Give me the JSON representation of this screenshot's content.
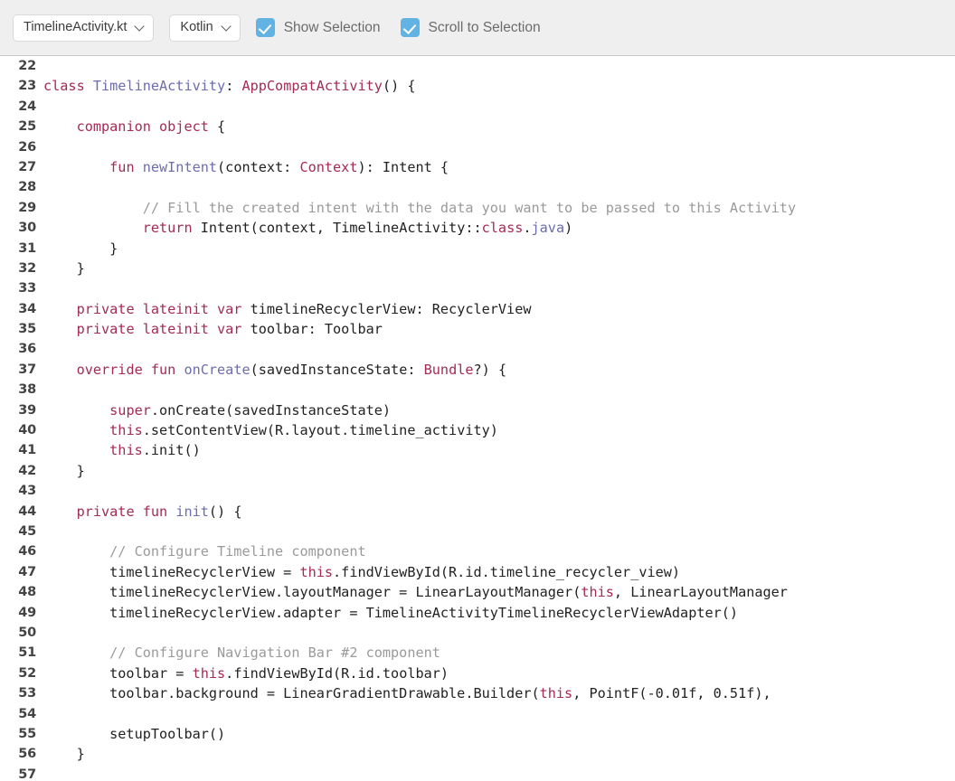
{
  "toolbar": {
    "file_select": {
      "value": "TimelineActivity.kt",
      "chevron_icon": "chevron-down-icon"
    },
    "language_select": {
      "value": "Kotlin",
      "chevron_icon": "chevron-down-icon"
    },
    "show_selection": {
      "label": "Show Selection",
      "checked": true
    },
    "scroll_to_selection": {
      "label": "Scroll to Selection",
      "checked": true
    },
    "background": "#efefef",
    "accent": "#62b3e4"
  },
  "editor": {
    "language": "Kotlin",
    "first_line": 22,
    "last_line": 57,
    "comment_color": "#9a9a9a",
    "keyword_color": "#a52a54",
    "identifier_color": "#6c6cae",
    "plain_color": "#222222",
    "lines": [
      {
        "n": "22",
        "tokens": []
      },
      {
        "n": "23",
        "tokens": [
          {
            "t": "class ",
            "c": "kw"
          },
          {
            "t": "TimelineActivity",
            "c": "idv"
          },
          {
            "t": ": ",
            "c": "pln"
          },
          {
            "t": "AppCompatActivity",
            "c": "typ"
          },
          {
            "t": "() {",
            "c": "pln"
          }
        ]
      },
      {
        "n": "24",
        "tokens": []
      },
      {
        "n": "25",
        "tokens": [
          {
            "t": "    ",
            "c": "pln"
          },
          {
            "t": "companion object",
            "c": "kw"
          },
          {
            "t": " {",
            "c": "pln"
          }
        ]
      },
      {
        "n": "26",
        "tokens": []
      },
      {
        "n": "27",
        "tokens": [
          {
            "t": "        ",
            "c": "pln"
          },
          {
            "t": "fun ",
            "c": "kw"
          },
          {
            "t": "newIntent",
            "c": "idv"
          },
          {
            "t": "(context: ",
            "c": "pln"
          },
          {
            "t": "Context",
            "c": "typ"
          },
          {
            "t": "): Intent {",
            "c": "pln"
          }
        ]
      },
      {
        "n": "28",
        "tokens": []
      },
      {
        "n": "29",
        "tokens": [
          {
            "t": "            ",
            "c": "pln"
          },
          {
            "t": "// Fill the created intent with the data you want to be passed to this Activity",
            "c": "cmt"
          }
        ]
      },
      {
        "n": "30",
        "tokens": [
          {
            "t": "            ",
            "c": "pln"
          },
          {
            "t": "return ",
            "c": "kw"
          },
          {
            "t": "Intent(context, TimelineActivity::",
            "c": "pln"
          },
          {
            "t": "class",
            "c": "kw"
          },
          {
            "t": ".",
            "c": "pln"
          },
          {
            "t": "java",
            "c": "idv"
          },
          {
            "t": ")",
            "c": "pln"
          }
        ]
      },
      {
        "n": "31",
        "tokens": [
          {
            "t": "        }",
            "c": "pln"
          }
        ]
      },
      {
        "n": "32",
        "tokens": [
          {
            "t": "    }",
            "c": "pln"
          }
        ]
      },
      {
        "n": "33",
        "tokens": []
      },
      {
        "n": "34",
        "tokens": [
          {
            "t": "    ",
            "c": "pln"
          },
          {
            "t": "private lateinit var",
            "c": "kw"
          },
          {
            "t": " timelineRecyclerView: RecyclerView",
            "c": "pln"
          }
        ]
      },
      {
        "n": "35",
        "tokens": [
          {
            "t": "    ",
            "c": "pln"
          },
          {
            "t": "private lateinit var",
            "c": "kw"
          },
          {
            "t": " toolbar: Toolbar",
            "c": "pln"
          }
        ]
      },
      {
        "n": "36",
        "tokens": []
      },
      {
        "n": "37",
        "tokens": [
          {
            "t": "    ",
            "c": "pln"
          },
          {
            "t": "override fun ",
            "c": "kw"
          },
          {
            "t": "onCreate",
            "c": "idv"
          },
          {
            "t": "(savedInstanceState: ",
            "c": "pln"
          },
          {
            "t": "Bundle",
            "c": "typ"
          },
          {
            "t": "?) {",
            "c": "pln"
          }
        ]
      },
      {
        "n": "38",
        "tokens": []
      },
      {
        "n": "39",
        "tokens": [
          {
            "t": "        ",
            "c": "pln"
          },
          {
            "t": "super",
            "c": "kw"
          },
          {
            "t": ".onCreate(savedInstanceState)",
            "c": "pln"
          }
        ]
      },
      {
        "n": "40",
        "tokens": [
          {
            "t": "        ",
            "c": "pln"
          },
          {
            "t": "this",
            "c": "kw"
          },
          {
            "t": ".setContentView(R.layout.timeline_activity)",
            "c": "pln"
          }
        ]
      },
      {
        "n": "41",
        "tokens": [
          {
            "t": "        ",
            "c": "pln"
          },
          {
            "t": "this",
            "c": "kw"
          },
          {
            "t": ".init()",
            "c": "pln"
          }
        ]
      },
      {
        "n": "42",
        "tokens": [
          {
            "t": "    }",
            "c": "pln"
          }
        ]
      },
      {
        "n": "43",
        "tokens": []
      },
      {
        "n": "44",
        "tokens": [
          {
            "t": "    ",
            "c": "pln"
          },
          {
            "t": "private fun ",
            "c": "kw"
          },
          {
            "t": "init",
            "c": "idv"
          },
          {
            "t": "() {",
            "c": "pln"
          }
        ]
      },
      {
        "n": "45",
        "tokens": []
      },
      {
        "n": "46",
        "tokens": [
          {
            "t": "        ",
            "c": "pln"
          },
          {
            "t": "// Configure Timeline component",
            "c": "cmt"
          }
        ]
      },
      {
        "n": "47",
        "tokens": [
          {
            "t": "        timelineRecyclerView = ",
            "c": "pln"
          },
          {
            "t": "this",
            "c": "kw"
          },
          {
            "t": ".findViewById(R.id.timeline_recycler_view)",
            "c": "pln"
          }
        ]
      },
      {
        "n": "48",
        "tokens": [
          {
            "t": "        timelineRecyclerView.layoutManager = LinearLayoutManager(",
            "c": "pln"
          },
          {
            "t": "this",
            "c": "kw"
          },
          {
            "t": ", LinearLayoutManager",
            "c": "pln"
          }
        ]
      },
      {
        "n": "49",
        "tokens": [
          {
            "t": "        timelineRecyclerView.adapter = TimelineActivityTimelineRecyclerViewAdapter()",
            "c": "pln"
          }
        ]
      },
      {
        "n": "50",
        "tokens": []
      },
      {
        "n": "51",
        "tokens": [
          {
            "t": "        ",
            "c": "pln"
          },
          {
            "t": "// Configure Navigation Bar #2 component",
            "c": "cmt"
          }
        ]
      },
      {
        "n": "52",
        "tokens": [
          {
            "t": "        toolbar = ",
            "c": "pln"
          },
          {
            "t": "this",
            "c": "kw"
          },
          {
            "t": ".findViewById(R.id.toolbar)",
            "c": "pln"
          }
        ]
      },
      {
        "n": "53",
        "tokens": [
          {
            "t": "        toolbar.background = LinearGradientDrawable.Builder(",
            "c": "pln"
          },
          {
            "t": "this",
            "c": "kw"
          },
          {
            "t": ", PointF(-0.01f, 0.51f),",
            "c": "pln"
          }
        ]
      },
      {
        "n": "54",
        "tokens": []
      },
      {
        "n": "55",
        "tokens": [
          {
            "t": "        setupToolbar()",
            "c": "pln"
          }
        ]
      },
      {
        "n": "56",
        "tokens": [
          {
            "t": "    }",
            "c": "pln"
          }
        ]
      },
      {
        "n": "57",
        "tokens": []
      }
    ]
  }
}
